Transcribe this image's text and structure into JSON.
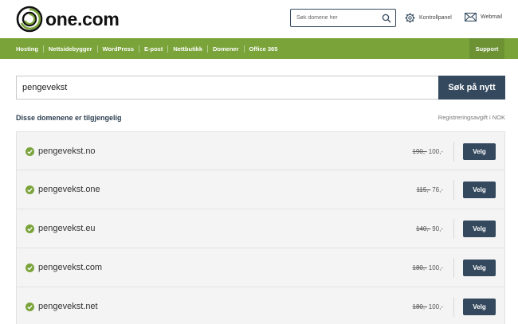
{
  "header": {
    "logo_text": "one.com",
    "search_placeholder": "Søk domene her",
    "control_panel_label": "Kontrollpanel",
    "webmail_label": "Webmail"
  },
  "nav": {
    "items": [
      "Hosting",
      "Nettsidebygger",
      "WordPress",
      "E-post",
      "Nettbutikk",
      "Domener",
      "Office 365"
    ],
    "support_label": "Support"
  },
  "domain_search": {
    "value": "pengevekst",
    "button_label": "Søk på nytt"
  },
  "results": {
    "title": "Disse domenene er tilgjengelig",
    "fee_note": "Registreringsavgift i NOK",
    "select_label": "Velg",
    "domains": [
      {
        "name": "pengevekst.no",
        "old_price": "190,-",
        "price": "100,-"
      },
      {
        "name": "pengevekst.one",
        "old_price": "115,-",
        "price": "76,-"
      },
      {
        "name": "pengevekst.eu",
        "old_price": "140,-",
        "price": "90,-"
      },
      {
        "name": "pengevekst.com",
        "old_price": "180,-",
        "price": "100,-"
      },
      {
        "name": "pengevekst.net",
        "old_price": "180,-",
        "price": "100,-"
      }
    ]
  },
  "colors": {
    "brand_green": "#7aa33a",
    "navy": "#34495e",
    "check_green": "#7aa33a"
  }
}
